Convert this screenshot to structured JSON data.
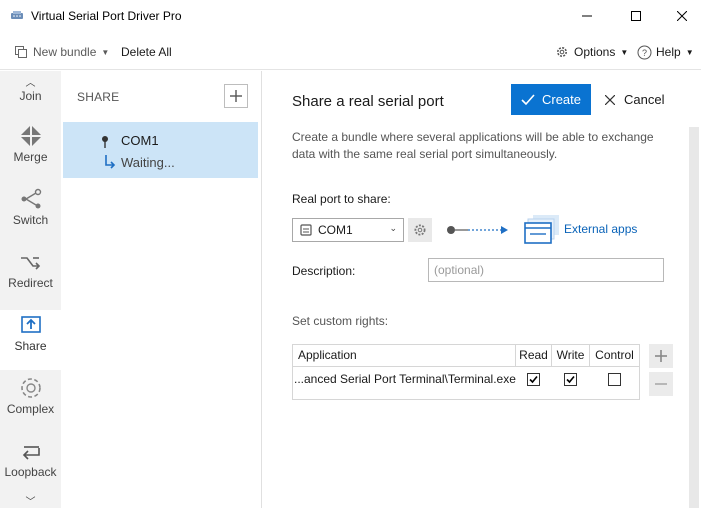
{
  "window": {
    "title": "Virtual Serial Port Driver Pro",
    "controls": {
      "minimize": "minimize-icon",
      "maximize": "maximize-icon",
      "close": "close-icon"
    }
  },
  "toolbar": {
    "new_bundle": "New bundle",
    "delete_all": "Delete All",
    "options": "Options",
    "help": "Help"
  },
  "nav": {
    "items": [
      {
        "label": "Join",
        "icon": "join-icon"
      },
      {
        "label": "Merge",
        "icon": "merge-icon"
      },
      {
        "label": "Switch",
        "icon": "switch-icon"
      },
      {
        "label": "Redirect",
        "icon": "redirect-icon"
      },
      {
        "label": "Share",
        "icon": "share-icon",
        "active": true
      },
      {
        "label": "Complex",
        "icon": "complex-icon"
      },
      {
        "label": "Loopback",
        "icon": "loopback-icon"
      }
    ]
  },
  "list": {
    "heading": "SHARE",
    "bundles": [
      {
        "port": "COM1",
        "status": "Waiting..."
      }
    ]
  },
  "main": {
    "title": "Share a real serial port",
    "create_label": "Create",
    "cancel_label": "Cancel",
    "description": "Create a bundle where several applications will be able to exchange data with the same real serial port simultaneously.",
    "real_port_label": "Real port to share:",
    "selected_port": "COM1",
    "external_apps_label": "External apps",
    "description_label": "Description:",
    "description_placeholder": "(optional)",
    "rights_label": "Set custom rights:",
    "rights_table": {
      "headers": [
        "Application",
        "Read",
        "Write",
        "Control"
      ],
      "rows": [
        {
          "application": "...anced Serial Port Terminal\\Terminal.exe",
          "read": true,
          "write": true,
          "control": false
        }
      ]
    }
  },
  "colors": {
    "accent": "#0a73d1",
    "selection": "#cce4f7",
    "nav_background": "#f2f2f2"
  }
}
